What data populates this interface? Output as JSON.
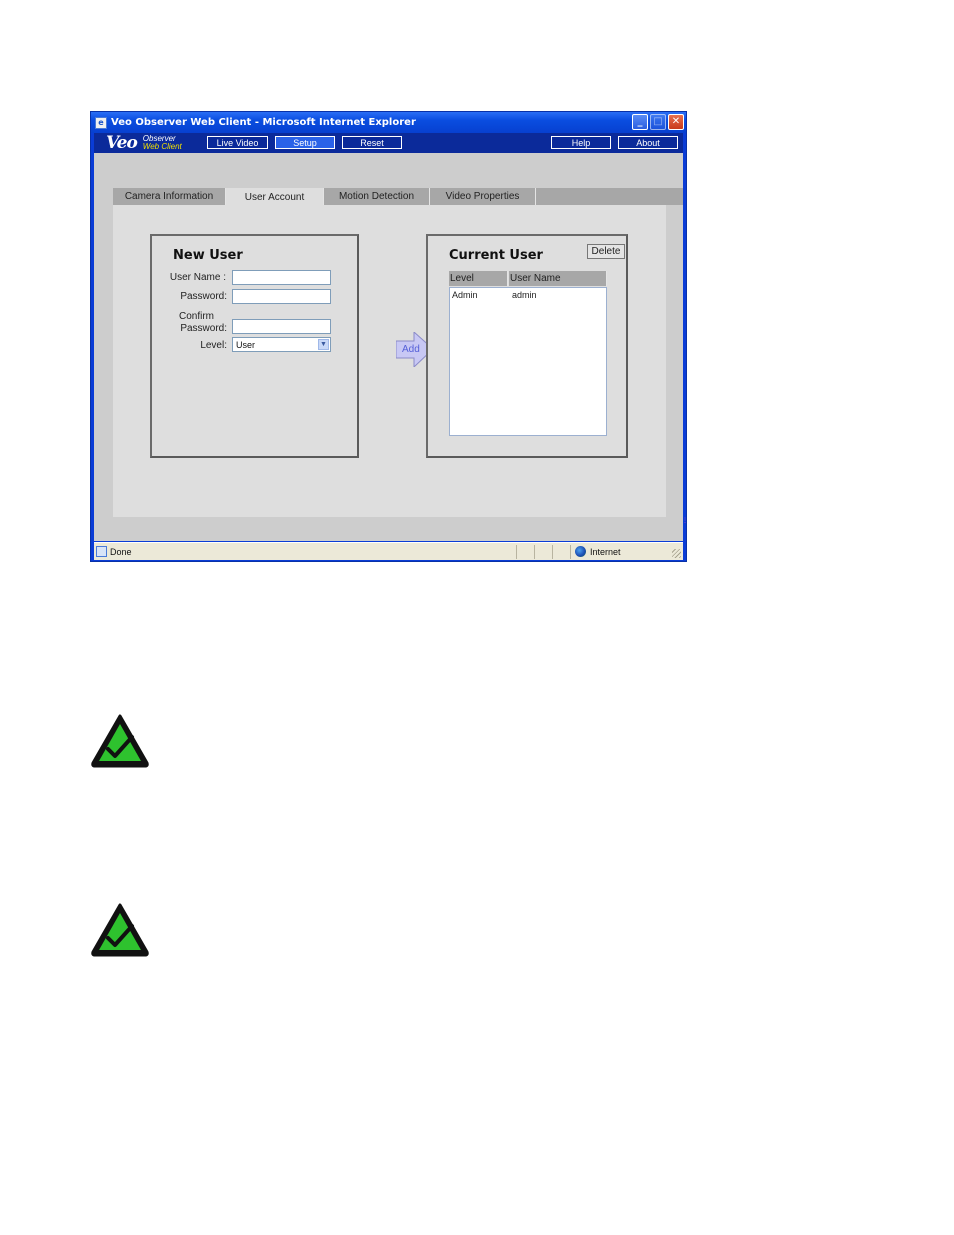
{
  "window": {
    "title": "Veo Observer Web Client - Microsoft Internet Explorer",
    "controls": [
      "minimize",
      "maximize",
      "close"
    ]
  },
  "app": {
    "logo": "Veo",
    "logo_line1": "Observer",
    "logo_line2": "Web Client",
    "nav": {
      "live_video": "Live Video",
      "setup": "Setup",
      "reset": "Reset",
      "help": "Help",
      "about": "About"
    },
    "active_nav": "Setup"
  },
  "tabs": [
    {
      "label": "Camera Information",
      "active": false
    },
    {
      "label": "User Account",
      "active": true
    },
    {
      "label": "Motion Detection",
      "active": false
    },
    {
      "label": "Video Properties",
      "active": false
    }
  ],
  "new_user": {
    "title": "New User",
    "username_label": "User Name :",
    "password_label": "Password:",
    "confirm_label_1": "Confirm",
    "confirm_label_2": "Password:",
    "level_label": "Level:",
    "username_value": "",
    "password_value": "",
    "confirm_value": "",
    "level_value": "User"
  },
  "add_button": "Add",
  "current_user": {
    "title": "Current User",
    "delete_button": "Delete",
    "columns": [
      "Level",
      "User Name"
    ],
    "rows": [
      {
        "level": "Admin",
        "username": "admin"
      }
    ]
  },
  "statusbar": {
    "status": "Done",
    "zone": "Internet"
  },
  "notes": [
    {
      "icon": "checkmark-note-icon"
    },
    {
      "icon": "checkmark-note-icon"
    }
  ]
}
